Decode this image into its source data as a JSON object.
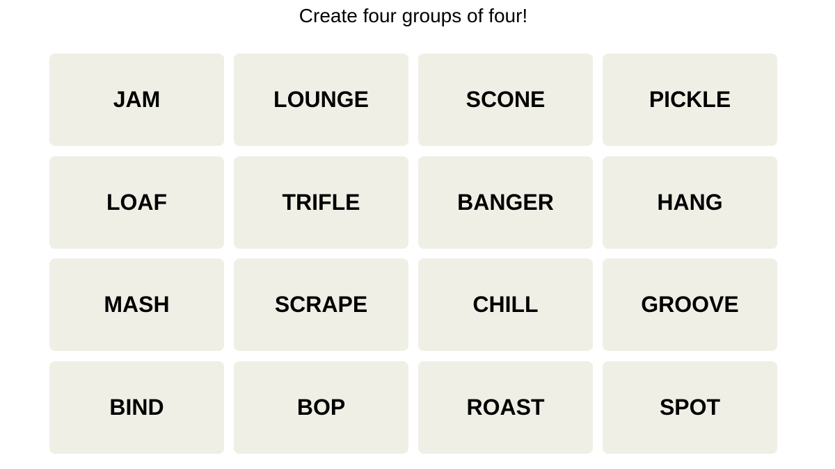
{
  "prompt": "Create four groups of four!",
  "tiles": [
    {
      "word": "JAM"
    },
    {
      "word": "LOUNGE"
    },
    {
      "word": "SCONE"
    },
    {
      "word": "PICKLE"
    },
    {
      "word": "LOAF"
    },
    {
      "word": "TRIFLE"
    },
    {
      "word": "BANGER"
    },
    {
      "word": "HANG"
    },
    {
      "word": "MASH"
    },
    {
      "word": "SCRAPE"
    },
    {
      "word": "CHILL"
    },
    {
      "word": "GROOVE"
    },
    {
      "word": "BIND"
    },
    {
      "word": "BOP"
    },
    {
      "word": "ROAST"
    },
    {
      "word": "SPOT"
    }
  ],
  "colors": {
    "tile_bg": "#efefe6",
    "text": "#000000",
    "background": "#ffffff"
  }
}
